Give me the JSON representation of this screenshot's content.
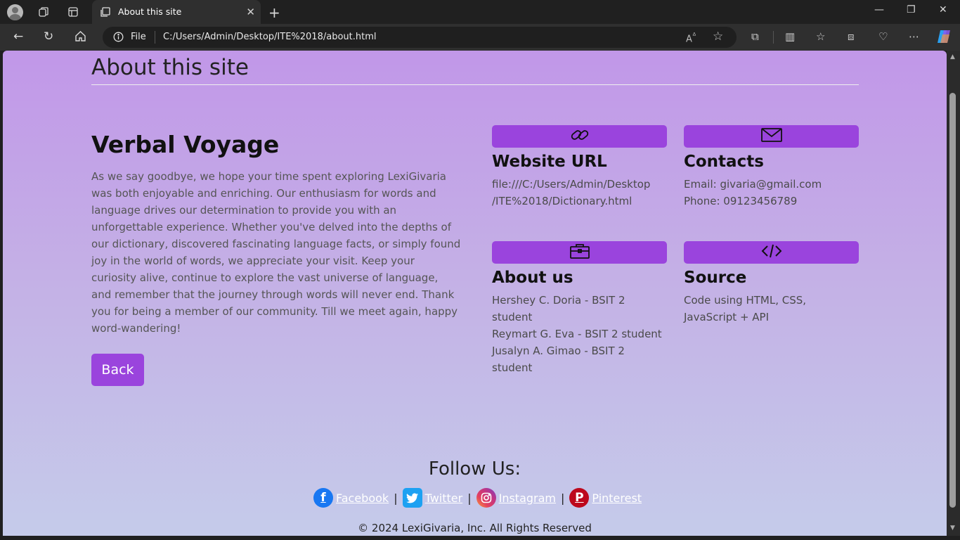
{
  "browser": {
    "tab_title": "About this site",
    "address_scheme": "File",
    "address_url": "C:/Users/Admin/Desktop/ITE%2018/about.html"
  },
  "page": {
    "title": "About this site",
    "site_name": "Verbal Voyage",
    "description": "As we say goodbye, we hope your time spent exploring LexiGivaria was both enjoyable and enriching. Our enthusiasm for words and language drives our determination to provide you with an unforgettable experience. Whether you've delved into the depths of our dictionary, discovered fascinating language facts, or simply found joy in the world of words, we appreciate your visit. Keep your curiosity alive, continue to explore the vast universe of language, and remember that the journey through words will never end. Thank you for being a member of our community. Till we meet again, happy word-wandering!",
    "back_label": "Back",
    "accent_color": "#9a44dd"
  },
  "cards": {
    "website": {
      "icon": "link-icon",
      "heading": "Website URL",
      "lines": [
        "file:///C:/Users/Admin/Desktop",
        "/ITE%2018/Dictionary.html"
      ]
    },
    "contacts": {
      "icon": "mail-icon",
      "heading": "Contacts",
      "lines": [
        "Email: givaria@gmail.com",
        "Phone: 09123456789"
      ]
    },
    "about": {
      "icon": "briefcase-icon",
      "heading": "About us",
      "lines": [
        "Hershey C. Doria - BSIT 2 student",
        "Reymart G. Eva - BSIT 2 student",
        "Jusalyn A. Gimao - BSIT 2 student"
      ]
    },
    "source": {
      "icon": "code-icon",
      "heading": "Source",
      "lines": [
        "Code using HTML, CSS, JavaScript + API"
      ]
    }
  },
  "footer": {
    "follow": "Follow Us:",
    "links": [
      {
        "label": " Facebook",
        "icon": "facebook-icon"
      },
      {
        "label": " Twitter",
        "icon": "twitter-icon"
      },
      {
        "label": " Instagram",
        "icon": "instagram-icon"
      },
      {
        "label": " Pinterest",
        "icon": "pinterest-icon"
      }
    ],
    "separator": "|",
    "copyright": "© 2024 LexiGivaria, Inc. All Rights Reserved"
  }
}
